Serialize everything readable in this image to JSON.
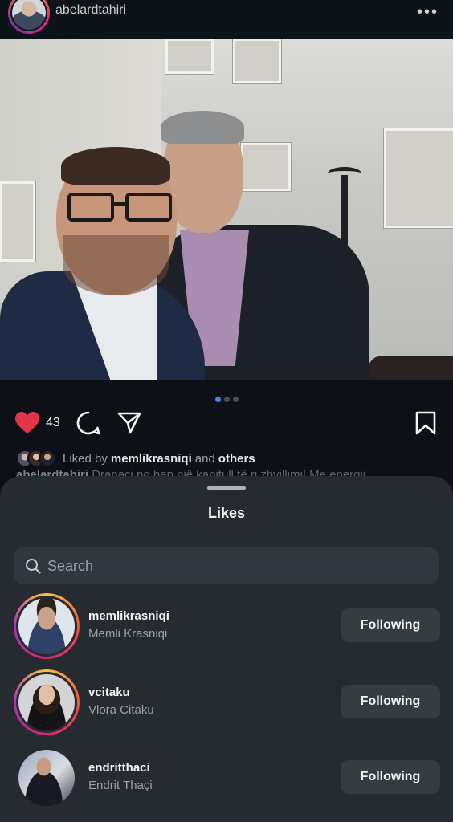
{
  "post": {
    "username": "abelardtahiri",
    "more_icon": "more-horizontal-icon",
    "carousel": {
      "count": 3,
      "active_index": 0
    },
    "like_count": "43",
    "liked_by_prefix": "Liked by",
    "liked_by_user": "memlikrasniqi",
    "liked_by_suffix": "and",
    "liked_by_others": "others",
    "caption_user": "abelardtahiri",
    "caption_text": "Dranaci po hap një kapitull të ri zhvillimi! Me energji..."
  },
  "likes_sheet": {
    "title": "Likes",
    "search_placeholder": "Search",
    "users": [
      {
        "username": "memlikrasniqi",
        "full_name": "Memli Krasniqi",
        "button": "Following",
        "story_ring": true
      },
      {
        "username": "vcitaku",
        "full_name": "Vlora Citaku",
        "button": "Following",
        "story_ring": true
      },
      {
        "username": "endritthaci",
        "full_name": "Endrit Thaçi",
        "button": "Following",
        "story_ring": false
      }
    ]
  },
  "colors": {
    "background": "#0d1117",
    "sheet": "#262b31",
    "heart": "#e3364b",
    "carousel_active": "#3d8af7",
    "button": "#363c44"
  }
}
